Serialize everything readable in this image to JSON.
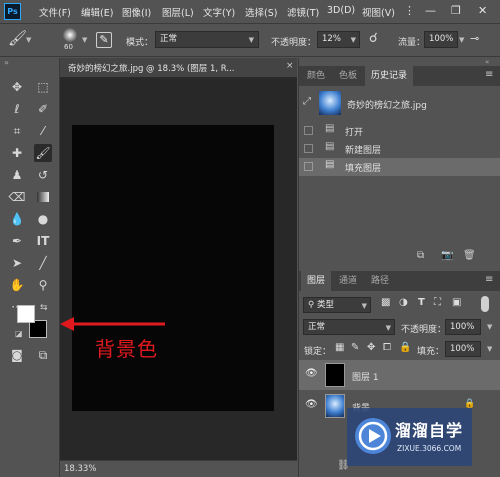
{
  "app": {
    "logo": "Ps"
  },
  "menu": [
    "文件(F)",
    "编辑(E)",
    "图像(I)",
    "图层(L)",
    "文字(Y)",
    "选择(S)",
    "滤镜(T)",
    "3D(D)",
    "视图(V)"
  ],
  "options": {
    "brush_size": "60",
    "mode_label": "模式：",
    "mode_value": "正常",
    "opacity_label": "不透明度：",
    "opacity_value": "12%",
    "flow_label": "流量：",
    "flow_value": "100%"
  },
  "document": {
    "tab_title": "奇妙的榜幻之旅.jpg @ 18.3% (图层 1, R...",
    "close_label": "×",
    "zoom_status": "18.33%",
    "canvas_color": "#060606"
  },
  "history_panel": {
    "tabs": [
      "颜色",
      "色板",
      "历史记录"
    ],
    "active_tab": 2,
    "snapshot_label": "奇妙的榜幻之旅.jpg",
    "states": [
      "打开",
      "新建图层",
      "填充图层"
    ]
  },
  "layers_panel": {
    "tabs": [
      "图层",
      "通道",
      "路径"
    ],
    "active_tab": 0,
    "filter_label": "类型",
    "blend_mode": "正常",
    "opacity_label": "不透明度：",
    "opacity_value": "100%",
    "lock_label": "锁定：",
    "fill_label": "填充：",
    "fill_value": "100%",
    "layers": [
      {
        "name": "图层 1",
        "selected": true
      },
      {
        "name": "背景",
        "selected": false
      }
    ]
  },
  "annotation": {
    "text": "背景色",
    "color": "#e0191f"
  },
  "watermark": {
    "title": "溜溜自学",
    "subtitle": "ZIXUE.3066.COM"
  }
}
